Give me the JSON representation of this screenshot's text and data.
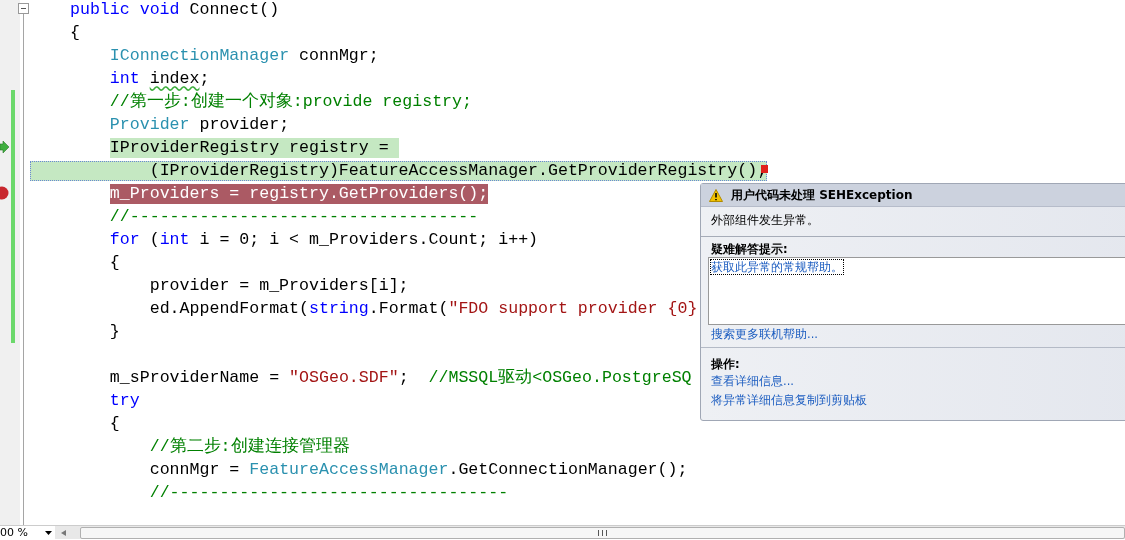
{
  "editor": {
    "lines": [
      {
        "changed": false,
        "current": false,
        "breakpoint": false,
        "expanded": true,
        "tokens": [
          {
            "kind": "keyword",
            "text": "public void"
          },
          {
            "kind": "plain",
            "text": " Connect()"
          }
        ]
      },
      {
        "changed": false,
        "current": false,
        "breakpoint": false,
        "tokens": [
          {
            "kind": "plain",
            "text": "{"
          }
        ]
      },
      {
        "changed": false,
        "current": false,
        "breakpoint": false,
        "tokens": [
          {
            "kind": "type",
            "text": "    IConnectionManager"
          },
          {
            "kind": "plain",
            "text": " connMgr;"
          }
        ]
      },
      {
        "changed": false,
        "current": false,
        "breakpoint": false,
        "tokens": [
          {
            "kind": "keyword",
            "text": "    int "
          },
          {
            "kind": "warned",
            "text": "index"
          },
          {
            "kind": "plain",
            "text": ";"
          }
        ]
      },
      {
        "changed": true,
        "current": false,
        "breakpoint": false,
        "tokens": [
          {
            "kind": "comment",
            "text": "    //第一步:创建一个对象:provide registry;"
          }
        ]
      },
      {
        "changed": true,
        "current": false,
        "breakpoint": false,
        "tokens": [
          {
            "kind": "type",
            "text": "    Provider"
          },
          {
            "kind": "plain",
            "text": " provider;"
          }
        ]
      },
      {
        "changed": true,
        "current": true,
        "breakpoint": false,
        "tokens": [
          {
            "kind": "plain",
            "text": "    IProviderRegistry registry = "
          }
        ]
      },
      {
        "changed": true,
        "current": true,
        "breakpoint": false,
        "tokens": [
          {
            "kind": "plain",
            "text": "        (IProviderRegistry)FeatureAccessManager.GetProviderRegistry();"
          }
        ]
      },
      {
        "changed": true,
        "current": false,
        "breakpoint": true,
        "tokens": [
          {
            "kind": "plain",
            "text": "    m_Providers = registry.GetProviders();"
          }
        ]
      },
      {
        "changed": true,
        "current": false,
        "breakpoint": false,
        "tokens": [
          {
            "kind": "comment",
            "text": "    //-----------------------------------"
          }
        ]
      },
      {
        "changed": true,
        "current": false,
        "breakpoint": false,
        "tokens": [
          {
            "kind": "keyword",
            "text": "    for"
          },
          {
            "kind": "plain",
            "text": " ("
          },
          {
            "kind": "keyword",
            "text": "int"
          },
          {
            "kind": "plain",
            "text": " i = 0; i < m_Providers.Count; i++)"
          }
        ]
      },
      {
        "changed": true,
        "current": false,
        "breakpoint": false,
        "tokens": [
          {
            "kind": "plain",
            "text": "    {"
          }
        ]
      },
      {
        "changed": true,
        "current": false,
        "breakpoint": false,
        "tokens": [
          {
            "kind": "plain",
            "text": "        provider = m_Providers[i];"
          }
        ]
      },
      {
        "changed": true,
        "current": false,
        "breakpoint": false,
        "tokens": [
          {
            "kind": "plain",
            "text": "        ed.AppendFormat("
          },
          {
            "kind": "keyword",
            "text": "string"
          },
          {
            "kind": "plain",
            "text": ".Format("
          },
          {
            "kind": "string",
            "text": "\"FDO support provider {0}"
          }
        ]
      },
      {
        "changed": true,
        "current": false,
        "breakpoint": false,
        "tokens": [
          {
            "kind": "plain",
            "text": "    }"
          }
        ]
      },
      {
        "changed": false,
        "current": false,
        "breakpoint": false
      },
      {
        "changed": false,
        "current": false,
        "breakpoint": false,
        "tokens": [
          {
            "kind": "plain",
            "text": "    m_sProviderName = "
          },
          {
            "kind": "string",
            "text": "\"OSGeo.SDF\""
          },
          {
            "kind": "plain",
            "text": ";  "
          },
          {
            "kind": "comment",
            "text": "//MSSQL驱动<OSGeo.PostgreSQ"
          }
        ]
      },
      {
        "changed": false,
        "current": false,
        "breakpoint": false,
        "tokens": [
          {
            "kind": "keyword",
            "text": "    try"
          }
        ]
      },
      {
        "changed": false,
        "current": false,
        "breakpoint": false,
        "tokens": [
          {
            "kind": "plain",
            "text": "    {"
          }
        ]
      },
      {
        "changed": false,
        "current": false,
        "breakpoint": false,
        "tokens": [
          {
            "kind": "comment",
            "text": "        //第二步:创建连接管理器"
          }
        ]
      },
      {
        "changed": false,
        "current": false,
        "breakpoint": false,
        "tokens": [
          {
            "kind": "plain",
            "text": "        connMgr = "
          },
          {
            "kind": "type",
            "text": "FeatureAccessManager"
          },
          {
            "kind": "plain",
            "text": ".GetConnectionManager();"
          }
        ]
      },
      {
        "changed": false,
        "current": false,
        "breakpoint": false,
        "tokens": [
          {
            "kind": "comment",
            "text": "        //----------------------------------"
          }
        ]
      }
    ]
  },
  "exception_popup": {
    "title": "用户代码未处理 SEHException",
    "message": "外部组件发生异常。",
    "tips_heading": "疑难解答提示:",
    "tips": [
      "获取此异常的常规帮助。"
    ],
    "search_link": "搜索更多联机帮助...",
    "actions_heading": "操作:",
    "actions": [
      "查看详细信息...",
      "将异常详细信息复制到剪贴板"
    ]
  },
  "status_bar": {
    "zoom": "00 %"
  }
}
